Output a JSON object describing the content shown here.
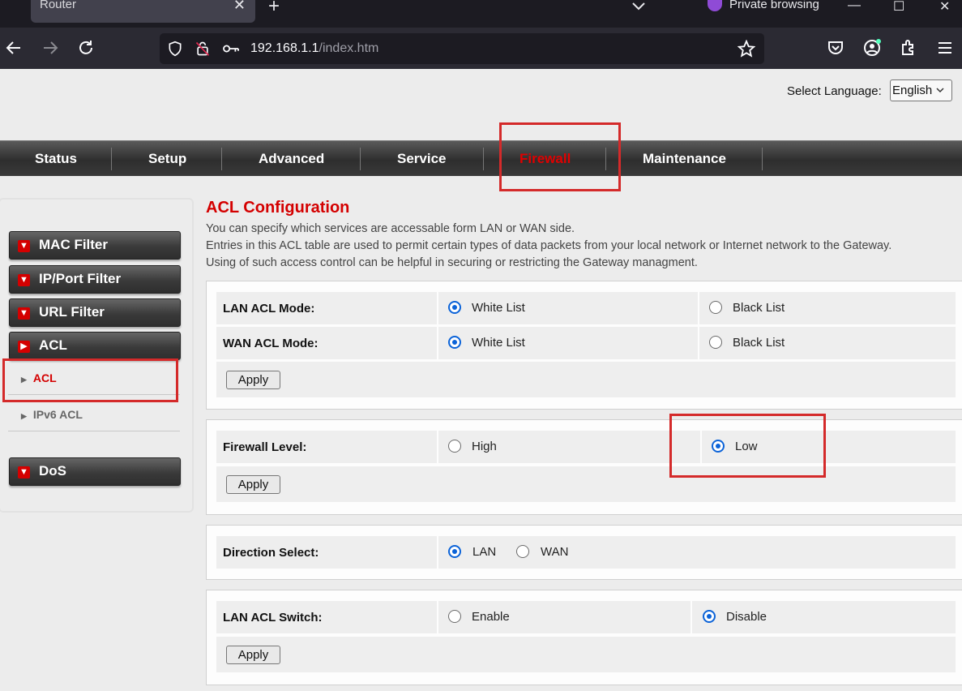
{
  "browser": {
    "tab_title": "Router",
    "private_label": "Private browsing",
    "url_host": "192.168.1.1",
    "url_path": "/index.htm"
  },
  "page": {
    "language_label": "Select Language:",
    "language_value": "English",
    "menu": [
      "Status",
      "Setup",
      "Advanced",
      "Service",
      "Firewall",
      "Maintenance"
    ],
    "active_menu": "Firewall",
    "sidebar": {
      "mac_filter": "MAC Filter",
      "ip_port_filter": "IP/Port Filter",
      "url_filter": "URL Filter",
      "acl": "ACL",
      "acl_sub": "ACL",
      "ipv6_acl_sub": "IPv6 ACL",
      "dos": "DoS"
    },
    "title": "ACL Configuration",
    "desc": [
      "You can specify which services are accessable form LAN or WAN side.",
      "Entries in this ACL table are used to permit certain types of data packets from your local network or Internet network to the Gateway.",
      "Using of such access control can be helpful in securing or restricting the Gateway managment."
    ],
    "acl_mode": {
      "lan_label": "LAN ACL Mode:",
      "wan_label": "WAN ACL Mode:",
      "white": "White List",
      "black": "Black List",
      "lan_selected": "White List",
      "wan_selected": "White List"
    },
    "firewall_level": {
      "label": "Firewall Level:",
      "high": "High",
      "low": "Low",
      "selected": "Low"
    },
    "direction": {
      "label": "Direction Select:",
      "lan": "LAN",
      "wan": "WAN",
      "selected": "LAN"
    },
    "lan_acl_switch": {
      "label": "LAN ACL Switch:",
      "enable": "Enable",
      "disable": "Disable",
      "selected": "Disable"
    },
    "apply_label": "Apply"
  },
  "colors": {
    "accent_red": "#d40000",
    "radio_blue": "#0b63d8",
    "highlight_box": "#d42a2a"
  }
}
